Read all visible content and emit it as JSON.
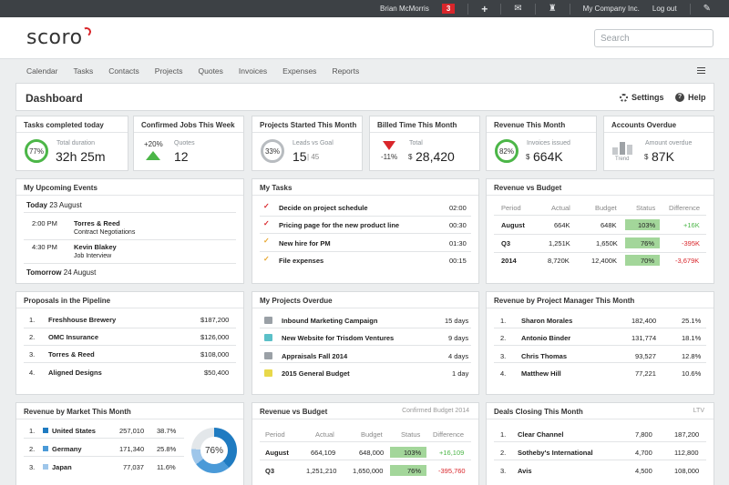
{
  "topbar": {
    "user": "Brian McMorris",
    "notifications": "3",
    "company": "My Company Inc.",
    "logout": "Log out"
  },
  "header": {
    "logo": "scoro",
    "search_placeholder": "Search"
  },
  "nav": {
    "items": [
      "Calendar",
      "Tasks",
      "Contacts",
      "Projects",
      "Quotes",
      "Invoices",
      "Expenses",
      "Reports"
    ]
  },
  "dashboard": {
    "title": "Dashboard",
    "settings": "Settings",
    "help": "Help"
  },
  "kpis": {
    "tasks": {
      "title": "Tasks completed today",
      "ring": "77%",
      "label": "Total duration",
      "value": "32h 25m"
    },
    "jobs": {
      "title": "Confirmed Jobs This Week",
      "change": "+20%",
      "label": "Quotes",
      "value": "12"
    },
    "projects": {
      "title": "Projects Started This Month",
      "ring": "33%",
      "label": "Leads vs Goal",
      "value": "15",
      "goal": "45"
    },
    "billed": {
      "title": "Billed Time This Month",
      "change": "-11%",
      "label": "Total",
      "currency": "$",
      "value": "28,420"
    },
    "revenue": {
      "title": "Revenue This Month",
      "ring": "82%",
      "label": "Invoices issued",
      "currency": "$",
      "value": "664K"
    },
    "overdue": {
      "title": "Accounts Overdue",
      "trend": "Trend",
      "label": "Amount overdue",
      "currency": "$",
      "value": "87K"
    }
  },
  "events": {
    "title": "My Upcoming Events",
    "today": "Today",
    "today_date": "23 August",
    "items": [
      {
        "time": "2:00 PM",
        "name": "Torres & Reed",
        "desc": "Contract Negotiations"
      },
      {
        "time": "4:30 PM",
        "name": "Kevin Blakey",
        "desc": "Job Interview"
      }
    ],
    "tomorrow": "Tomorrow",
    "tomorrow_date": "24 August"
  },
  "tasks": {
    "title": "My Tasks",
    "items": [
      {
        "name": "Decide on project schedule",
        "time": "02:00"
      },
      {
        "name": "Pricing page for the new product line",
        "time": "00:30"
      },
      {
        "name": "New hire for PM",
        "time": "01:30"
      },
      {
        "name": "File expenses",
        "time": "00:15"
      }
    ]
  },
  "rvb": {
    "title": "Revenue vs Budget",
    "headers": [
      "Period",
      "Actual",
      "Budget",
      "Status",
      "Difference"
    ],
    "rows": [
      {
        "period": "August",
        "actual": "664K",
        "budget": "648K",
        "status": "103%",
        "diff": "+16K"
      },
      {
        "period": "Q3",
        "actual": "1,251K",
        "budget": "1,650K",
        "status": "76%",
        "diff": "-395K"
      },
      {
        "period": "2014",
        "actual": "8,720K",
        "budget": "12,400K",
        "status": "70%",
        "diff": "-3,679K"
      }
    ]
  },
  "pipeline": {
    "title": "Proposals in the Pipeline",
    "items": [
      {
        "n": "1.",
        "name": "Freshhouse Brewery",
        "value": "$187,200"
      },
      {
        "n": "2.",
        "name": "OMC Insurance",
        "value": "$126,000"
      },
      {
        "n": "3.",
        "name": "Torres & Reed",
        "value": "$108,000"
      },
      {
        "n": "4.",
        "name": "Aligned Designs",
        "value": "$50,400"
      }
    ]
  },
  "overdue_projects": {
    "title": "My Projects Overdue",
    "items": [
      {
        "name": "Inbound Marketing Campaign",
        "days": "15 days",
        "color": "#9aa0a6"
      },
      {
        "name": "New Website for Trisdom Ventures",
        "days": "9 days",
        "color": "#5bc0c8"
      },
      {
        "name": "Appraisals Fall 2014",
        "days": "4 days",
        "color": "#9aa0a6"
      },
      {
        "name": "2015 General Budget",
        "days": "1 day",
        "color": "#e8d84a"
      }
    ]
  },
  "managers": {
    "title": "Revenue by Project Manager This Month",
    "items": [
      {
        "n": "1.",
        "name": "Sharon Morales",
        "value": "182,400",
        "pct": "25.1%"
      },
      {
        "n": "2.",
        "name": "Antonio Binder",
        "value": "131,774",
        "pct": "18.1%"
      },
      {
        "n": "3.",
        "name": "Chris Thomas",
        "value": "93,527",
        "pct": "12.8%"
      },
      {
        "n": "4.",
        "name": "Matthew Hill",
        "value": "77,221",
        "pct": "10.6%"
      }
    ]
  },
  "market": {
    "title": "Revenue by Market This Month",
    "donut": "76%",
    "items": [
      {
        "n": "1.",
        "name": "United States",
        "value": "257,010",
        "pct": "38.7%",
        "color": "#1f7bc1"
      },
      {
        "n": "2.",
        "name": "Germany",
        "value": "171,340",
        "pct": "25.8%",
        "color": "#4a9ad8"
      },
      {
        "n": "3.",
        "name": "Japan",
        "value": "77,037",
        "pct": "11.6%",
        "color": "#9ec6ea"
      }
    ]
  },
  "rvb2": {
    "title": "Revenue vs Budget",
    "sub": "Confirmed Budget 2014",
    "headers": [
      "Period",
      "Actual",
      "Budget",
      "Status",
      "Difference"
    ],
    "rows": [
      {
        "period": "August",
        "actual": "664,109",
        "budget": "648,000",
        "status": "103%",
        "diff": "+16,109"
      },
      {
        "period": "Q3",
        "actual": "1,251,210",
        "budget": "1,650,000",
        "status": "76%",
        "diff": "-395,760"
      }
    ]
  },
  "deals": {
    "title": "Deals Closing This Month",
    "sub": "LTV",
    "items": [
      {
        "n": "1.",
        "name": "Clear Channel",
        "value": "7,800",
        "ltv": "187,200"
      },
      {
        "n": "2.",
        "name": "Sotheby's International",
        "value": "4,700",
        "ltv": "112,800"
      },
      {
        "n": "3.",
        "name": "Avis",
        "value": "4,500",
        "ltv": "108,000"
      }
    ]
  }
}
